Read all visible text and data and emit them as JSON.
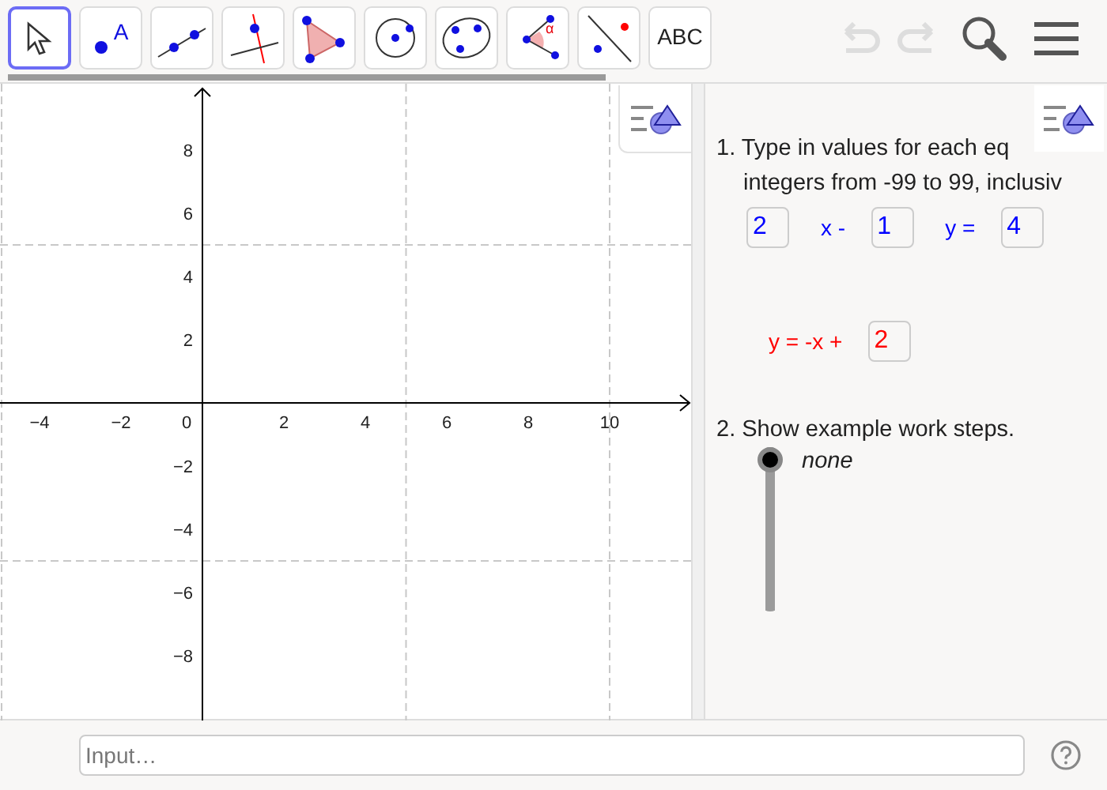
{
  "toolbar": {
    "tools": [
      {
        "kind": "move",
        "selected": true
      },
      {
        "kind": "point",
        "selected": false,
        "text": "A"
      },
      {
        "kind": "line",
        "selected": false
      },
      {
        "kind": "perpendicular",
        "selected": false
      },
      {
        "kind": "polygon",
        "selected": false
      },
      {
        "kind": "circle",
        "selected": false
      },
      {
        "kind": "conic",
        "selected": false
      },
      {
        "kind": "angle",
        "selected": false,
        "text": "α"
      },
      {
        "kind": "reflect",
        "selected": false
      },
      {
        "kind": "text",
        "selected": false,
        "text": "ABC"
      }
    ],
    "undo_enabled": false,
    "redo_enabled": false
  },
  "graphics": {
    "x_labels": [
      "−4",
      "−2",
      "0",
      "2",
      "4",
      "6",
      "8",
      "10"
    ],
    "y_labels": [
      "8",
      "6",
      "4",
      "2",
      "−2",
      "−4",
      "−6",
      "−8"
    ]
  },
  "panel": {
    "task_1": [
      "1. Type in values for each eq",
      "integers from -99 to 99, inclusiv"
    ],
    "equations": [
      {
        "color": "#0000ff",
        "parts": [
          {
            "kind": "input",
            "text": "2"
          },
          {
            "kind": "text",
            "text": "x -"
          },
          {
            "kind": "input",
            "text": "1"
          },
          {
            "kind": "text",
            "text": "y ="
          },
          {
            "kind": "input",
            "text": "4"
          }
        ]
      },
      {
        "color": "#ff0000",
        "parts": [
          {
            "kind": "text",
            "text": "y = -x +"
          },
          {
            "kind": "input",
            "text": "2"
          }
        ]
      }
    ],
    "task_2": "2. Show example work steps.",
    "slider": {
      "label": "none",
      "level": 1
    }
  },
  "input_bar": {
    "placeholder": "Input…"
  }
}
